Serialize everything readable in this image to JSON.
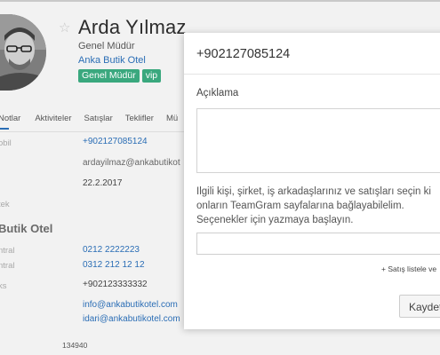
{
  "contact": {
    "name": "Arda Yılmaz",
    "title": "Genel Müdür",
    "company": "Anka Butik Otel",
    "tags": [
      "Genel Müdür",
      "vip"
    ],
    "favorite_icon": "star-outline"
  },
  "tabs": [
    "Notlar",
    "Aktiviteler",
    "Satışlar",
    "Teklifler",
    "Mü"
  ],
  "details": {
    "mobile_label": "obil",
    "mobile": "+902127085124",
    "email": "ardayilmaz@ankabutikot",
    "date": "22.2.2017",
    "misc_label": "tek"
  },
  "company_section": {
    "title": "Butik Otel",
    "phone1_label": "ntral",
    "phone1": "0212 2222223",
    "phone2_label": "ntral",
    "phone2": "0312 212 12 12",
    "fax_label": "ks",
    "fax": "+902123333332",
    "email1": "info@ankabutikotel.com",
    "email2": "idari@ankabutikotel.com"
  },
  "footer_number": "134940",
  "modal": {
    "phone_title": "+902127085124",
    "description_label": "Açıklama",
    "help_text": "Ilgili kişi, şirket, iş arkadaşlarınız ve satışları seçin ki onların TeamGram sayfalarına bağlayabilelim. Seçenekler için yazmaya başlayın.",
    "add_sale_link": "+ Satış listele ve",
    "save_label": "Kaydet"
  }
}
